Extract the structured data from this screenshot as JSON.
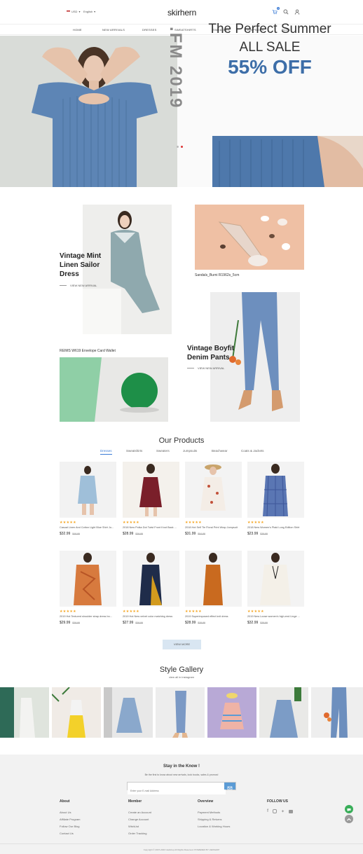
{
  "header": {
    "currency": "USD",
    "language": "English",
    "logo": "skirhern",
    "cart_count": "0"
  },
  "nav": {
    "items": [
      "HOME",
      "NEW ARRIVALS",
      "DRESSES",
      "SWEATSHIRTS",
      "SWEATERS",
      "JUMPSUITS",
      "BLOG"
    ]
  },
  "hero": {
    "vertical_text": ".FM 2019",
    "title": "The Perfect Summer",
    "subtitle": "ALL SALE",
    "discount": "55% OFF"
  },
  "promos": {
    "dress_title_1": "Vintage Mint",
    "dress_title_2": "Linen Sailor",
    "dress_title_3": "Dress",
    "dress_link": "VIEW NEW ARRIVAL",
    "sandals_caption": "Sandals_Burni R1962s_5cm",
    "wallet_caption": "REIMS W619 Envelope Card Wallet",
    "pants_title_1": "Vintage Boyfit",
    "pants_title_2": "Denim Pants",
    "pants_link": "VIEW NEW ARRIVAL"
  },
  "products": {
    "title": "Our Products",
    "tabs": [
      "Dresses",
      "Sweatshirts",
      "Sweaters",
      "Jumpsuits",
      "Beachwear",
      "Coats & Jackets"
    ],
    "items": [
      {
        "name": "Casual Linen And Cotton Light Blue Shirt Ju...",
        "price": "$32.99",
        "old": "$49.99",
        "stars": "★★★★★"
      },
      {
        "name": "2018 New Polka Dot Twist Front Knot Back ...",
        "price": "$28.99",
        "old": "$39.99",
        "stars": "★★★★★"
      },
      {
        "name": "2018 Hot Self Tie Floral Print Wrap Jumpsuit",
        "price": "$31.99",
        "old": "$54.99",
        "stars": "★★★★★"
      },
      {
        "name": "2018 New Women's Plaid Long Edition Shirt",
        "price": "$23.99",
        "old": "$39.99",
        "stars": "★★★★★"
      },
      {
        "name": "2019 Hot Textured shoulder strap dress bo...",
        "price": "$29.99",
        "old": "$39.99",
        "stars": "★★★★★"
      },
      {
        "name": "2019 Hot New velvet color matching dress",
        "price": "$27.99",
        "old": "$39.99",
        "stars": "★★★★★"
      },
      {
        "name": "2019 Superimposed effect knit dress",
        "price": "$28.99",
        "old": "$39.99",
        "stars": "★★★★★"
      },
      {
        "name": "2019 New Loose women's high-end Linge ...",
        "price": "$32.99",
        "old": "$39.99",
        "stars": "★★★★★"
      }
    ],
    "view_more": "VIEW MORE"
  },
  "gallery": {
    "title": "Style Gallery",
    "subtitle": "view all in instagram"
  },
  "footer": {
    "subscribe_title": "Stay in the Know !",
    "subscribe_desc": "Be the first to know about new arrivals, look books, sales & promos!",
    "email_placeholder": "Enter your E-mail Address",
    "about_head": "About",
    "about_items": [
      "About Us",
      "Affiliate Program",
      "Follow Our Blog",
      "Contact Us"
    ],
    "member_head": "Member",
    "member_items": [
      "Create an Account",
      "Change Account",
      "WishList",
      "Order Tracking"
    ],
    "overview_head": "Overview",
    "overview_items": [
      "Payment Methods",
      "Shipping & Returns",
      "Location & Working Hours"
    ],
    "follow_head": "FOLLOW US",
    "copyright": "Copyright © 2007-2023 Uedshop All Rights Reserved. POWERED BY UEDSHOP"
  },
  "colors": {
    "accent": "#3a7bd5",
    "discount": "#3d6ea8",
    "stars": "#f5a623",
    "chat": "#3aae5a"
  }
}
